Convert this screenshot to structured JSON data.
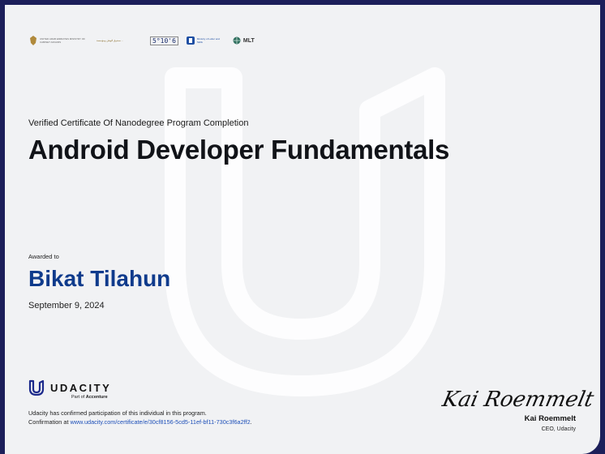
{
  "logos": {
    "uae_caption": "UNITED ARAB EMIRATES MINISTRY OF CABINET AFFAIRS",
    "fund_caption": "صندوق الوطن ومؤسسة ...",
    "five_ten": "5°10'6",
    "labor_caption": "Ministry of Labor and Skills",
    "mlt": "MLT"
  },
  "certificate": {
    "subtitle": "Verified Certificate Of Nanodegree Program Completion",
    "title": "Android Developer Fundamentals",
    "awarded_label": "Awarded to",
    "recipient": "Bikat Tilahun",
    "date": "September 9, 2024"
  },
  "udacity": {
    "wordmark": "UDACITY",
    "part_of_prefix": "Part of ",
    "part_of_brand": "Accenture",
    "confirm_text": "Udacity has confirmed participation of this individual in this program.",
    "confirmation_label": "Confirmation at ",
    "confirmation_url": "www.udacity.com/certificate/e/30cf8156-5cd5-11ef-bf11-730c3f6a2ff2",
    "confirmation_end": "."
  },
  "signature": {
    "script": "Kai Roemmelt",
    "name": "Kai Roemmelt",
    "role": "CEO, Udacity"
  },
  "colors": {
    "frame": "#1c1f5a",
    "paper": "#f1f2f4",
    "recipient": "#0f3b8c",
    "link": "#1d4fb8"
  }
}
